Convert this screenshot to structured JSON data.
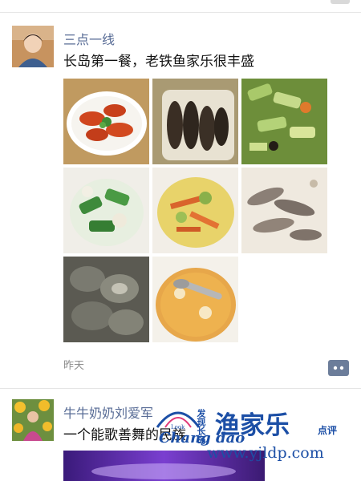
{
  "posts": [
    {
      "user_name": "三点一线",
      "text": "长岛第一餐，老铁鱼家乐很丰盛",
      "photos": [
        "shrimp-photo",
        "sea-cucumber-photo",
        "cucumber-salad-photo",
        "cucumber-dish-photo",
        "stir-fry-photo",
        "mantis-shrimp-photo",
        "abalone-photo",
        "soup-photo"
      ],
      "time": "昨天",
      "comment_icon": "comment-icon"
    },
    {
      "user_name": "牛牛奶奶刘爱军",
      "text": "一个能歌善舞的民族"
    }
  ],
  "watermark": {
    "logo_text": "Chang dao",
    "logo_small": "Look",
    "side_text": "发现长岛",
    "brand": "渔家乐",
    "brand_sub": "点评",
    "url": "www.yjldp.com"
  },
  "colors": {
    "name": "#576b95",
    "watermark": "#1c4fa6"
  }
}
